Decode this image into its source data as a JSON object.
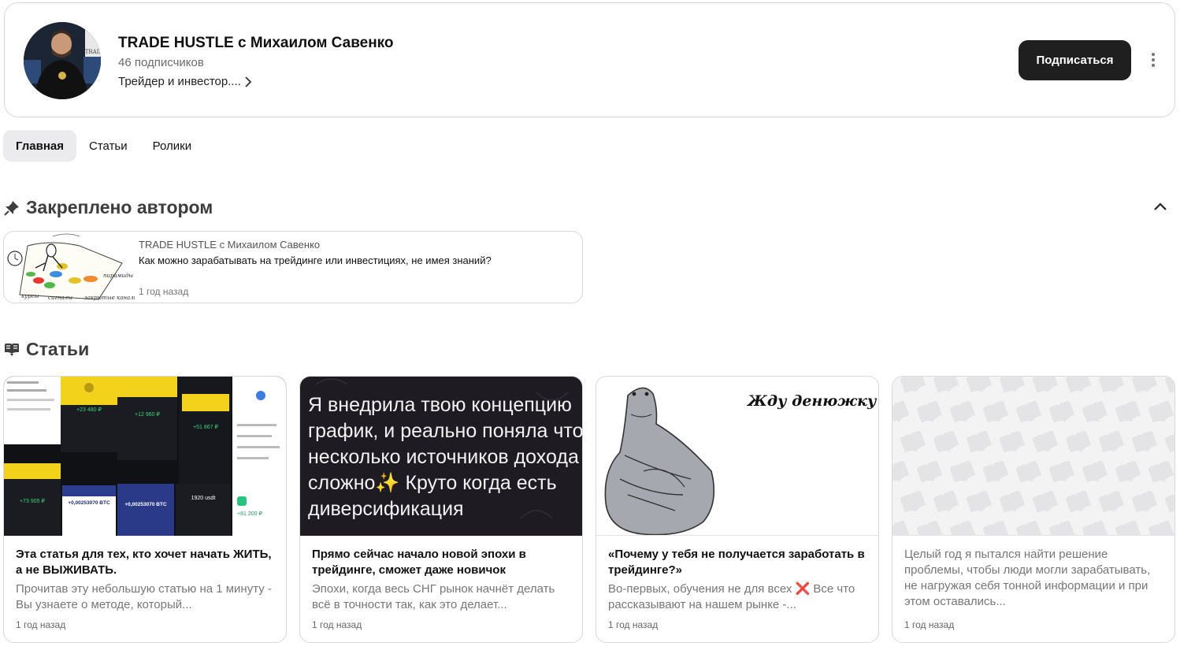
{
  "header": {
    "title": "TRADE HUSTLE с Михаилом Савенко",
    "subscribers": "46 подписчиков",
    "description": "Трейдер и инвестор....",
    "subscribe_label": "Подписаться",
    "avatar_badge": "TRAD"
  },
  "tabs": [
    {
      "label": "Главная",
      "active": true
    },
    {
      "label": "Статьи",
      "active": false
    },
    {
      "label": "Ролики",
      "active": false
    }
  ],
  "pinned": {
    "heading": "Закреплено автором",
    "author": "TRADE HUSTLE с Михаилом Савенко",
    "title": "Как можно зарабатывать на трейдинге или инвестициях, не имея знаний?",
    "time": "1 год назад",
    "image_words": [
      "курсы",
      "сигналы",
      "закрытые каналы",
      "пирамиды"
    ]
  },
  "articles": {
    "heading": "Статьи",
    "cards": [
      {
        "title": "Эта статья для тех, кто хочет начать ЖИТЬ, а не ВЫЖИВАТЬ.",
        "snippet": "Прочитав эту небольшую статью на 1 минуту - Вы узнаете о методе, который...",
        "time": "1 год назад",
        "image_amounts": [
          "+23 480 ₽",
          "+12 960 ₽",
          "+51 867 ₽",
          "+73 905 ₽",
          "+0,00253070 BTC",
          "+0,00253070 BTC",
          "1920 usdt",
          "+81 200 ₽"
        ]
      },
      {
        "title": "Прямо сейчас начало новой эпохи в трейдинге, сможет даже новичок",
        "snippet": "Эпохи, когда весь СНГ рынок начнёт делать всё в точности так, как это делает...",
        "time": "1 год назад",
        "image_lines": [
          "Я внедрила твою концепцию",
          "график, и реально поняла что",
          "несколько источников дохода",
          "сложно✨ Круто когда есть",
          "диверсификация"
        ]
      },
      {
        "title": "«Почему у тебя не получается заработать в трейдинге?»",
        "snippet": "Во-первых, обучения не для всех ❌ Все что рассказывают на нашем рынке -...",
        "time": "1 год назад",
        "image_caption": "Жду денюжку"
      },
      {
        "title": "",
        "snippet": "Целый год я пытался найти решение проблемы, чтобы люди могли зарабатывать, не нагружая себя тонной информации и при этом оставались...",
        "time": "1 год назад"
      }
    ]
  },
  "colors": {
    "subscribe_bg": "#1f1f1f",
    "tab_active_bg": "#ebebed",
    "border": "#d9d9d9",
    "muted_text": "#777777",
    "screenshot_yellow": "#f2d21a",
    "dark_bg": "#1e1b22",
    "meme_figure": "#a6a8b0"
  }
}
